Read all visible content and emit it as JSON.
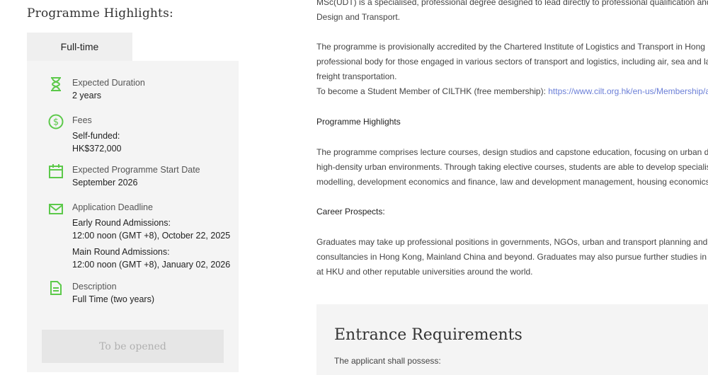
{
  "sidebar": {
    "title": "Programme Highlights:",
    "tab_label": "Full-time",
    "items": [
      {
        "icon": "hourglass-icon",
        "label": "Expected Duration",
        "values": [
          "2 years"
        ]
      },
      {
        "icon": "dollar-icon",
        "label": "Fees",
        "values": [
          "Self-funded:",
          "HK$372,000"
        ]
      },
      {
        "icon": "calendar-icon",
        "label": "Expected Programme Start Date",
        "values": [
          "September 2026"
        ]
      },
      {
        "icon": "mail-icon",
        "label": "Application Deadline",
        "values": [
          "Early Round Admissions:",
          "12:00 noon (GMT +8), October 22, 2025",
          "",
          "Main Round Admissions:",
          "12:00 noon (GMT +8), January 02, 2026"
        ]
      },
      {
        "icon": "document-icon",
        "label": "Description",
        "values": [
          "Full Time (two years)"
        ]
      }
    ],
    "button_label": "To be opened"
  },
  "main": {
    "intro_lines": [
      "MSc(UDT) is a specialised, professional degree designed to lead directly to professional qualification and reg",
      "Design and Transport."
    ],
    "accreditation_lines": [
      "The programme is provisionally accredited by the Chartered Institute of Logistics and Transport in Hong Kong",
      "professional body for those engaged in various sectors of transport and logistics, including air, sea and land,",
      "freight transportation."
    ],
    "membership_text": "To become a Student Member of CILTHK (free membership):",
    "membership_link": "https://www.cilt.org.hk/en-us/Membership/appl",
    "highlights_heading": "Programme Highlights",
    "highlights_lines": [
      "The programme comprises lecture courses, design studios and capstone education, focusing on urban desig",
      "high-density urban environments. Through taking elective courses, students are able to develop specialism in",
      "modelling, development economics and finance, law and development management, housing economics an"
    ],
    "career_heading": "Career Prospects:",
    "career_lines": [
      "Graduates may take up professional positions in governments, NGOs, urban and transport planning and desi",
      "consultancies in Hong Kong, Mainland China and beyond. Graduates may also pursue further studies in the M",
      "at HKU and other reputable universities around the world."
    ],
    "entrance_title": "Entrance Requirements",
    "entrance_sub": "The applicant shall possess:"
  },
  "colors": {
    "accent_green": "#5cc94a",
    "link": "#6b7fd7"
  }
}
